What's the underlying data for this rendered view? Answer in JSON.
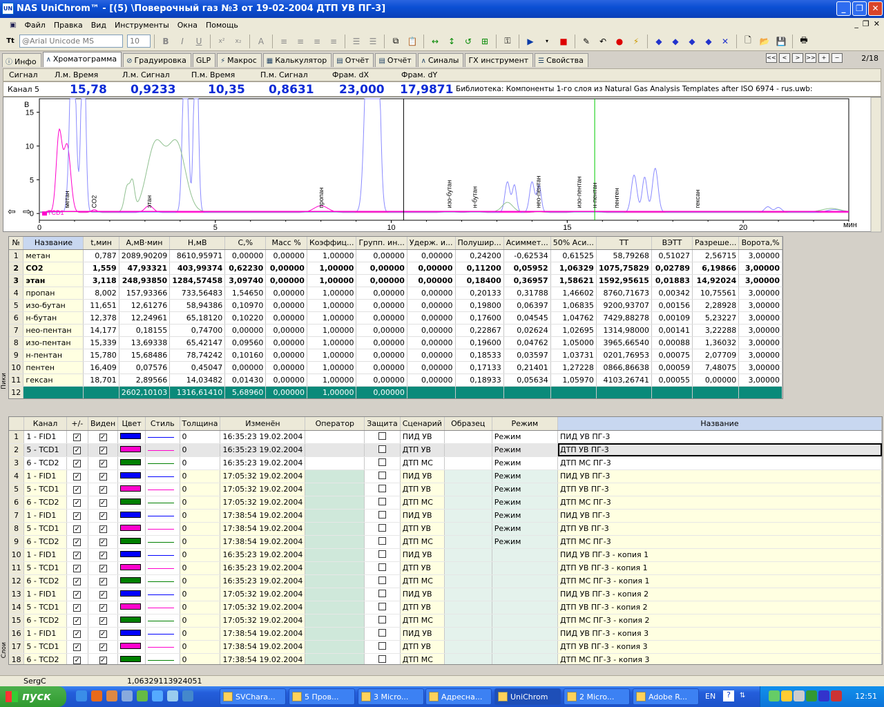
{
  "window": {
    "title": "NAS UniChrom™ - [(5) \\Поверочный газ  №3  от 19-02-2004 ДТП УВ ПГ-3]"
  },
  "menu": [
    "Файл",
    "Правка",
    "Вид",
    "Инструменты",
    "Окна",
    "Помощь"
  ],
  "toolbar": {
    "font_name": "@Arial Unicode MS",
    "font_size": "10"
  },
  "tabs": [
    "Инфо",
    "Хроматограмма",
    "Градуировка",
    "GLP",
    "Макрос",
    "Калькулятор",
    "Отчёт",
    "Отчёт",
    "Синалы",
    "ГХ инструмент",
    "Свойства"
  ],
  "page_indicator": "2/18",
  "signal_header": {
    "signal": "Сигнал",
    "l_time": "Л.м. Время",
    "l_signal": "Л.м. Сигнал",
    "r_time": "П.м. Время",
    "r_signal": "П.м. Сигнал",
    "frame_dx": "Фрам. dX",
    "frame_dy": "Фрам. dY"
  },
  "signal_values": {
    "channel": "Канал 5",
    "l_time": "15,78",
    "l_signal": "0,9233",
    "r_time": "10,35",
    "r_signal": "0,8631",
    "frame_dx": "23,000",
    "frame_dy": "17,9871",
    "library": "Библиотека: Компоненты 1-го слоя из Natural Gas Analysis Templates after ISO 6974 - rus.uwb:"
  },
  "chart_data": {
    "type": "line",
    "ylabel": "В",
    "xlabel": "мин",
    "xlim": [
      0,
      23
    ],
    "ylim": [
      -1,
      17
    ],
    "x_ticks": [
      "0",
      "5",
      "10",
      "15",
      "20"
    ],
    "y_ticks": [
      "0",
      "5",
      "10",
      "15"
    ],
    "trace_label": "TCD1",
    "peak_labels": [
      {
        "name": "метан",
        "t": 0.787
      },
      {
        "name": "CO2",
        "t": 1.559
      },
      {
        "name": "этан",
        "t": 3.118
      },
      {
        "name": "пропан",
        "t": 8.002
      },
      {
        "name": "изо-бутан",
        "t": 11.651
      },
      {
        "name": "н-бутан",
        "t": 12.378
      },
      {
        "name": "нео-пентан",
        "t": 14.177
      },
      {
        "name": "изо-пентан",
        "t": 15.339
      },
      {
        "name": "н-пентан",
        "t": 15.78
      },
      {
        "name": "пентен",
        "t": 16.409
      },
      {
        "name": "гексан",
        "t": 18.701
      }
    ],
    "cursor_black_t": 10.35,
    "cursor_green_t": 15.78,
    "series": [
      {
        "name": "TCD1",
        "color": "#ff00cc",
        "peaks": [
          [
            0.56,
            11.5,
            0.08
          ],
          [
            0.787,
            10,
            0.1
          ],
          [
            1.559,
            0.4,
            0.08
          ],
          [
            3.118,
            1.0,
            0.12
          ],
          [
            8.002,
            1.0,
            0.2
          ],
          [
            11.65,
            0.12,
            0.15
          ],
          [
            12.38,
            0.12,
            0.15
          ],
          [
            14.18,
            0.1,
            0.15
          ],
          [
            15.34,
            0.12,
            0.15
          ],
          [
            15.78,
            0.1,
            0.15
          ]
        ]
      },
      {
        "name": "FID1",
        "color": "#8a8aff",
        "peaks": [
          [
            0.95,
            30,
            0.08
          ],
          [
            1.25,
            30,
            0.06
          ],
          [
            4.15,
            30,
            0.07
          ],
          [
            4.45,
            30,
            0.06
          ],
          [
            9.35,
            30,
            0.1
          ],
          [
            9.6,
            30,
            0.08
          ],
          [
            13.3,
            4.5,
            0.07
          ],
          [
            13.5,
            4.0,
            0.06
          ],
          [
            14.0,
            4.5,
            0.07
          ],
          [
            14.2,
            4.0,
            0.06
          ],
          [
            16.9,
            5.5,
            0.08
          ],
          [
            17.2,
            5.2,
            0.07
          ],
          [
            17.5,
            6.5,
            0.08
          ],
          [
            20.7,
            0.8,
            0.09
          ],
          [
            21.0,
            0.7,
            0.09
          ],
          [
            22.6,
            0.4,
            0.2
          ]
        ]
      },
      {
        "name": "TCD2",
        "color": "#90c090",
        "peaks": [
          [
            2.5,
            3.8,
            0.08
          ],
          [
            2.65,
            3.8,
            0.06
          ],
          [
            3.3,
            10,
            0.25
          ],
          [
            3.9,
            10,
            0.25
          ],
          [
            13.3,
            1.4,
            0.15
          ],
          [
            22.5,
            0.5,
            0.25
          ]
        ]
      }
    ]
  },
  "peak_table": {
    "headers": [
      "№",
      "Название",
      "t,мин",
      "A,мВ·мин",
      "H,мВ",
      "C,%",
      "Масс %",
      "Коэффиц...",
      "Групп. ин...",
      "Удерж. и...",
      "Полушир...",
      "Асиммет...",
      "50% Аси...",
      "TT",
      "ВЭТТ",
      "Разреше...",
      "Ворота,%"
    ],
    "rows": [
      [
        "1",
        "метан",
        "0,787",
        "2089,90209",
        "8610,95971",
        "0,00000",
        "0,00000",
        "1,00000",
        "0,00000",
        "0,00000",
        "0,24200",
        "-0,62534",
        "0,61525",
        "58,79268",
        "0,51027",
        "2,56715",
        "3,00000"
      ],
      [
        "2",
        "CO2",
        "1,559",
        "47,93321",
        "403,99374",
        "0,62230",
        "0,00000",
        "1,00000",
        "0,00000",
        "0,00000",
        "0,11200",
        "0,05952",
        "1,06329",
        "1075,75829",
        "0,02789",
        "6,19866",
        "3,00000"
      ],
      [
        "3",
        "этан",
        "3,118",
        "248,93850",
        "1284,57458",
        "3,09740",
        "0,00000",
        "1,00000",
        "0,00000",
        "0,00000",
        "0,18400",
        "0,36957",
        "1,58621",
        "1592,95615",
        "0,01883",
        "14,92024",
        "3,00000"
      ],
      [
        "4",
        "пропан",
        "8,002",
        "157,93366",
        "733,56483",
        "1,54650",
        "0,00000",
        "1,00000",
        "0,00000",
        "0,00000",
        "0,20133",
        "0,31788",
        "1,46602",
        "8760,71673",
        "0,00342",
        "10,75561",
        "3,00000"
      ],
      [
        "5",
        "изо-бутан",
        "11,651",
        "12,61276",
        "58,94386",
        "0,10970",
        "0,00000",
        "1,00000",
        "0,00000",
        "0,00000",
        "0,19800",
        "0,06397",
        "1,06835",
        "9200,93707",
        "0,00156",
        "2,28928",
        "3,00000"
      ],
      [
        "6",
        "н-бутан",
        "12,378",
        "12,24961",
        "65,18120",
        "0,10220",
        "0,00000",
        "1,00000",
        "0,00000",
        "0,00000",
        "0,17600",
        "0,04545",
        "1,04762",
        "7429,88278",
        "0,00109",
        "5,23227",
        "3,00000"
      ],
      [
        "7",
        "нео-пентан",
        "14,177",
        "0,18155",
        "0,74700",
        "0,00000",
        "0,00000",
        "1,00000",
        "0,00000",
        "0,00000",
        "0,22867",
        "0,02624",
        "1,02695",
        "1314,98000",
        "0,00141",
        "3,22288",
        "3,00000"
      ],
      [
        "8",
        "изо-пентан",
        "15,339",
        "13,69338",
        "65,42147",
        "0,09560",
        "0,00000",
        "1,00000",
        "0,00000",
        "0,00000",
        "0,19600",
        "0,04762",
        "1,05000",
        "3965,66540",
        "0,00088",
        "1,36032",
        "3,00000"
      ],
      [
        "9",
        "н-пентан",
        "15,780",
        "15,68486",
        "78,74242",
        "0,10160",
        "0,00000",
        "1,00000",
        "0,00000",
        "0,00000",
        "0,18533",
        "0,03597",
        "1,03731",
        "0201,76953",
        "0,00075",
        "2,07709",
        "3,00000"
      ],
      [
        "10",
        "пентен",
        "16,409",
        "0,07576",
        "0,45047",
        "0,00000",
        "0,00000",
        "1,00000",
        "0,00000",
        "0,00000",
        "0,17133",
        "0,21401",
        "1,27228",
        "0866,86638",
        "0,00059",
        "7,48075",
        "3,00000"
      ],
      [
        "11",
        "гексан",
        "18,701",
        "2,89566",
        "14,03482",
        "0,01430",
        "0,00000",
        "1,00000",
        "0,00000",
        "0,00000",
        "0,18933",
        "0,05634",
        "1,05970",
        "4103,26741",
        "0,00055",
        "0,00000",
        "3,00000"
      ]
    ],
    "total": [
      "12",
      "",
      "",
      "2602,10103",
      "1316,61410",
      "5,68960",
      "0,00000",
      "1,00000",
      "0,00000",
      "",
      "",
      "",
      "",
      "",
      "",
      "",
      ""
    ]
  },
  "side_labels": {
    "peaks": "Пики",
    "layers": "Слои"
  },
  "layer_table": {
    "headers": [
      "",
      "Канал",
      "+/-",
      "Виден",
      "Цвет",
      "Стиль",
      "Толщина",
      "Изменён",
      "Оператор",
      "Защита",
      "Сценарий",
      "Образец",
      "Режим",
      "Название"
    ],
    "rows": [
      {
        "n": "1",
        "ch": "1 - FID1",
        "color": "#0000ff",
        "lc": "#0000ff",
        "t": "16:35:23 19.02.2004",
        "sc": "ПИД  УВ",
        "mode": "Режим",
        "name": "ПИД УВ ПГ-3"
      },
      {
        "n": "2",
        "ch": "5 - TCD1",
        "color": "#ff00cc",
        "lc": "#ff00cc",
        "t": "16:35:23 19.02.2004",
        "sc": "ДТП  УВ",
        "mode": "Режим",
        "name": "ДТП УВ ПГ-3"
      },
      {
        "n": "3",
        "ch": "6 - TCD2",
        "color": "#008000",
        "lc": "#008000",
        "t": "16:35:23 19.02.2004",
        "sc": "ДТП  МС",
        "mode": "Режим",
        "name": "ДТП МС ПГ-3"
      },
      {
        "n": "4",
        "ch": "1 - FID1",
        "color": "#0000ff",
        "lc": "#0000ff",
        "t": "17:05:32 19.02.2004",
        "sc": "ПИД  УВ",
        "mode": "Режим",
        "name": "ПИД УВ ПГ-3"
      },
      {
        "n": "5",
        "ch": "5 - TCD1",
        "color": "#ff00cc",
        "lc": "#ff00cc",
        "t": "17:05:32 19.02.2004",
        "sc": "ДТП  УВ",
        "mode": "Режим",
        "name": "ДТП УВ ПГ-3"
      },
      {
        "n": "6",
        "ch": "6 - TCD2",
        "color": "#008000",
        "lc": "#008000",
        "t": "17:05:32 19.02.2004",
        "sc": "ДТП  МС",
        "mode": "Режим",
        "name": "ДТП МС ПГ-3"
      },
      {
        "n": "7",
        "ch": "1 - FID1",
        "color": "#0000ff",
        "lc": "#0000ff",
        "t": "17:38:54 19.02.2004",
        "sc": "ПИД  УВ",
        "mode": "Режим",
        "name": "ПИД УВ ПГ-3"
      },
      {
        "n": "8",
        "ch": "5 - TCD1",
        "color": "#ff00cc",
        "lc": "#ff00cc",
        "t": "17:38:54 19.02.2004",
        "sc": "ДТП  УВ",
        "mode": "Режим",
        "name": "ДТП УВ ПГ-3"
      },
      {
        "n": "9",
        "ch": "6 - TCD2",
        "color": "#008000",
        "lc": "#008000",
        "t": "17:38:54 19.02.2004",
        "sc": "ДТП  МС",
        "mode": "Режим",
        "name": "ДТП МС ПГ-3"
      },
      {
        "n": "10",
        "ch": "1 - FID1",
        "color": "#0000ff",
        "lc": "#0000ff",
        "t": "16:35:23 19.02.2004",
        "sc": "ПИД  УВ",
        "mode": "",
        "name": "ПИД УВ ПГ-3 - копия 1"
      },
      {
        "n": "11",
        "ch": "5 - TCD1",
        "color": "#ff00cc",
        "lc": "#ff00cc",
        "t": "16:35:23 19.02.2004",
        "sc": "ДТП  УВ",
        "mode": "",
        "name": "ДТП УВ ПГ-3  - копия 1"
      },
      {
        "n": "12",
        "ch": "6 - TCD2",
        "color": "#008000",
        "lc": "#008000",
        "t": "16:35:23 19.02.2004",
        "sc": "ДТП  МС",
        "mode": "",
        "name": "ДТП МС ПГ-3 - копия 1"
      },
      {
        "n": "13",
        "ch": "1 - FID1",
        "color": "#0000ff",
        "lc": "#0000ff",
        "t": "17:05:32 19.02.2004",
        "sc": "ПИД  УВ",
        "mode": "",
        "name": "ПИД УВ ПГ-3 - копия 2"
      },
      {
        "n": "14",
        "ch": "5 - TCD1",
        "color": "#ff00cc",
        "lc": "#ff00cc",
        "t": "17:05:32 19.02.2004",
        "sc": "ДТП  УВ",
        "mode": "",
        "name": "ДТП УВ ПГ-3  - копия 2"
      },
      {
        "n": "15",
        "ch": "6 - TCD2",
        "color": "#008000",
        "lc": "#008000",
        "t": "17:05:32 19.02.2004",
        "sc": "ДТП  МС",
        "mode": "",
        "name": "ДТП МС ПГ-3 - копия 2"
      },
      {
        "n": "16",
        "ch": "1 - FID1",
        "color": "#0000ff",
        "lc": "#0000ff",
        "t": "17:38:54 19.02.2004",
        "sc": "ПИД  УВ",
        "mode": "",
        "name": "ПИД УВ ПГ-3 - копия 3"
      },
      {
        "n": "17",
        "ch": "5 - TCD1",
        "color": "#ff00cc",
        "lc": "#ff00cc",
        "t": "17:38:54 19.02.2004",
        "sc": "ДТП  УВ",
        "mode": "",
        "name": "ДТП УВ ПГ-3  - копия 3"
      },
      {
        "n": "18",
        "ch": "6 - TCD2",
        "color": "#008000",
        "lc": "#008000",
        "t": "17:38:54 19.02.2004",
        "sc": "ДТП  МС",
        "mode": "",
        "name": "ДТП МС ПГ-3 - копия 3"
      }
    ],
    "thickness": "0"
  },
  "status": {
    "user": "SergC",
    "value": "1,06329113924051"
  },
  "taskbar": {
    "start": "пуск",
    "tasks": [
      "SVChara...",
      "5 Пров...",
      "3 Micro...",
      "Адресна...",
      "UniChrom",
      "2 Micro...",
      "Adobe R..."
    ],
    "lang": "EN",
    "clock": "12:51"
  }
}
